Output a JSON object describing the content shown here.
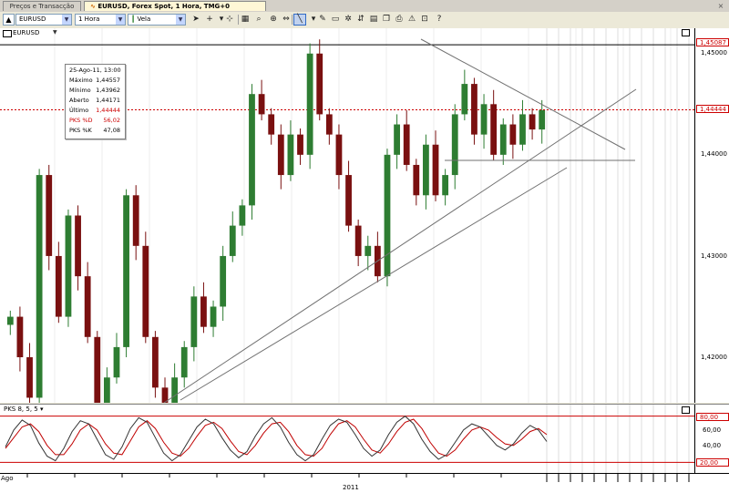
{
  "tabs": [
    {
      "label": "Preços e Transacção"
    },
    {
      "label": "EURUSD, Forex Spot, 1 Hora, TMG+0"
    }
  ],
  "toolbar": {
    "symbol": "EURUSD",
    "interval": "1 Hora",
    "chart_type": "Vela"
  },
  "chart": {
    "symbol": "EURUSD",
    "price_ticks": [
      "1,45000",
      "1,44000",
      "1,43000",
      "1,42000"
    ],
    "current_price": "1,44444",
    "high_price": "1,45087",
    "colors": {
      "up": "#2e7d32",
      "down": "#7a1010",
      "trendline": "#707070",
      "price_line": "#cc0000"
    }
  },
  "tooltip": {
    "date": "25-Ago-11, 13:00",
    "rows": [
      {
        "label": "Máximo",
        "value": "1,44557"
      },
      {
        "label": "Mínimo",
        "value": "1,43962"
      },
      {
        "label": "Aberto",
        "value": "1,44171"
      },
      {
        "label": "Último",
        "value": "1,44444"
      },
      {
        "label": "PKS %D",
        "value": "56,02"
      },
      {
        "label": "PKS %K",
        "value": "47,08"
      }
    ]
  },
  "oscillator": {
    "label": "PKS 8, 5, 5",
    "ticks": [
      "80,00",
      "60,00",
      "40,00",
      "20,00"
    ]
  },
  "time_axis": {
    "month": "Ago",
    "year": "2011"
  },
  "chart_data": {
    "type": "candlestick",
    "symbol": "EURUSD",
    "interval": "1 Hora",
    "y_ticks": [
      1.45,
      1.44,
      1.43,
      1.42
    ],
    "ylim": [
      1.4155,
      1.4525
    ],
    "price_close": [
      1.424,
      1.42,
      1.416,
      1.438,
      1.43,
      1.424,
      1.434,
      1.428,
      1.422,
      1.415,
      1.418,
      1.421,
      1.436,
      1.431,
      1.422,
      1.417,
      1.415,
      1.418,
      1.421,
      1.426,
      1.423,
      1.425,
      1.43,
      1.433,
      1.435,
      1.446,
      1.444,
      1.442,
      1.438,
      1.442,
      1.44,
      1.45,
      1.444,
      1.442,
      1.438,
      1.433,
      1.43,
      1.431,
      1.428,
      1.44,
      1.443,
      1.439,
      1.436,
      1.441,
      1.436,
      1.438,
      1.444,
      1.447,
      1.442,
      1.445,
      1.44,
      1.443,
      1.441,
      1.444,
      1.4425,
      1.4444
    ],
    "current_price": 1.44444,
    "high_price": 1.45087,
    "oscillator": {
      "name": "PKS 8, 5, 5",
      "ylim": [
        5,
        95
      ],
      "levels": [
        80,
        20
      ],
      "k": [
        40,
        62,
        75,
        68,
        45,
        28,
        22,
        38,
        60,
        74,
        70,
        50,
        30,
        24,
        40,
        64,
        78,
        72,
        52,
        32,
        22,
        30,
        48,
        66,
        76,
        70,
        52,
        36,
        26,
        34,
        54,
        70,
        78,
        66,
        46,
        30,
        22,
        30,
        50,
        68,
        76,
        72,
        56,
        38,
        28,
        36,
        56,
        72,
        80,
        70,
        50,
        34,
        24,
        30,
        46,
        62,
        70,
        66,
        54,
        42,
        36,
        44,
        58,
        68,
        62,
        47
      ],
      "d": [
        38,
        52,
        66,
        70,
        60,
        42,
        30,
        30,
        44,
        62,
        70,
        62,
        44,
        32,
        30,
        48,
        66,
        74,
        64,
        46,
        32,
        28,
        38,
        54,
        68,
        72,
        64,
        48,
        34,
        30,
        42,
        58,
        70,
        72,
        60,
        42,
        30,
        28,
        38,
        56,
        70,
        74,
        66,
        50,
        36,
        32,
        44,
        60,
        72,
        76,
        64,
        46,
        32,
        28,
        36,
        50,
        62,
        66,
        62,
        52,
        44,
        42,
        50,
        60,
        64,
        56
      ]
    }
  }
}
